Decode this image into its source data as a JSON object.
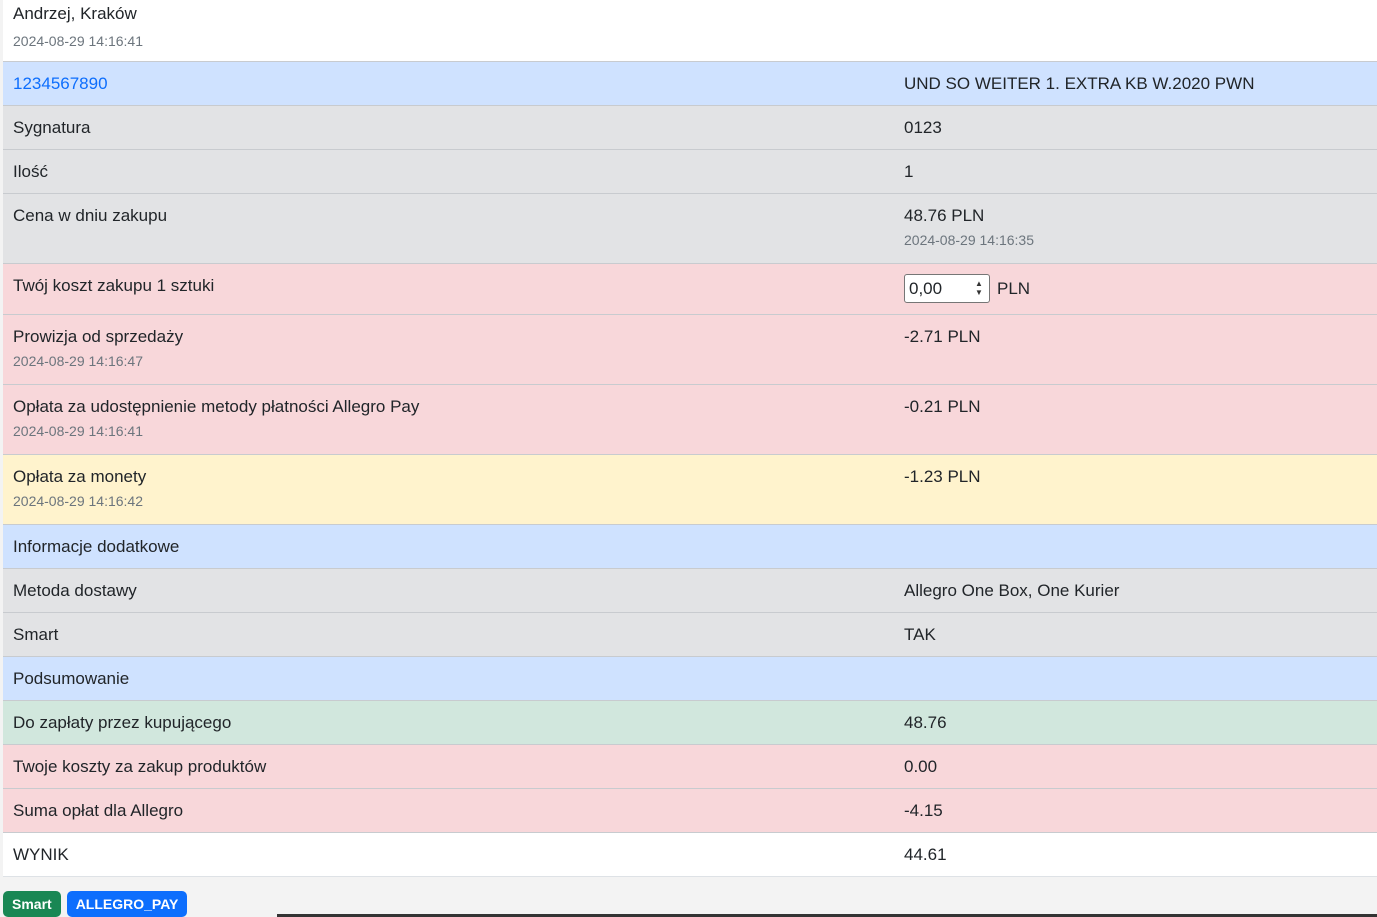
{
  "header": {
    "buyer": "Andrzej, Kraków",
    "timestamp": "2024-08-29 14:16:41"
  },
  "product": {
    "offer_id": "1234567890",
    "title": "UND SO WEITER 1. EXTRA KB W.2020 PWN"
  },
  "rows": {
    "signature_label": "Sygnatura",
    "signature_value": "0123",
    "quantity_label": "Ilość",
    "quantity_value": "1",
    "price_label": "Cena w dniu zakupu",
    "price_value": "48.76 PLN",
    "price_timestamp": "2024-08-29 14:16:35",
    "cost_label": "Twój koszt zakupu 1 sztuki",
    "cost_input_value": "0,00",
    "cost_unit": "PLN",
    "commission_label": "Prowizja od sprzedaży",
    "commission_timestamp": "2024-08-29 14:16:47",
    "commission_value": "-2.71 PLN",
    "allegro_pay_label": "Opłata za udostępnienie metody płatności Allegro Pay",
    "allegro_pay_timestamp": "2024-08-29 14:16:41",
    "allegro_pay_value": "-0.21 PLN",
    "coins_label": "Opłata za monety",
    "coins_timestamp": "2024-08-29 14:16:42",
    "coins_value": "-1.23 PLN"
  },
  "additional": {
    "section_title": "Informacje dodatkowe",
    "delivery_label": "Metoda dostawy",
    "delivery_value": "Allegro One Box, One Kurier",
    "smart_label": "Smart",
    "smart_value": "TAK"
  },
  "summary": {
    "section_title": "Podsumowanie",
    "buyer_pays_label": "Do zapłaty przez kupującego",
    "buyer_pays_value": "48.76",
    "product_costs_label": "Twoje koszty za zakup produktów",
    "product_costs_value": "0.00",
    "allegro_fees_label": "Suma opłat dla Allegro",
    "allegro_fees_value": "-4.15",
    "result_label": "WYNIK",
    "result_value": "44.61"
  },
  "badges": {
    "smart": "Smart",
    "allegro_pay": "ALLEGRO_PAY"
  },
  "colors": {
    "primary_row": "#cfe2ff",
    "secondary_row": "#e2e3e5",
    "danger_row": "#f8d7da",
    "warning_row": "#fff3cd",
    "success_row": "#d1e7dd",
    "badge_green": "#198754",
    "badge_blue": "#0d6efd"
  }
}
